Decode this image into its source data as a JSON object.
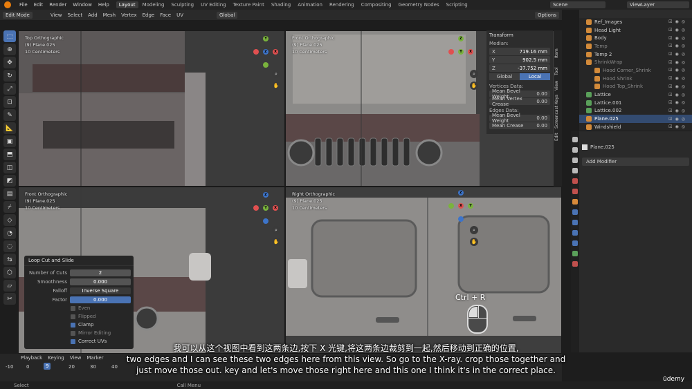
{
  "app": {
    "menus": [
      "File",
      "Edit",
      "Render",
      "Window",
      "Help"
    ],
    "workspaces": [
      "Layout",
      "Modeling",
      "Sculpting",
      "UV Editing",
      "Texture Paint",
      "Shading",
      "Animation",
      "Rendering",
      "Compositing",
      "Geometry Nodes",
      "Scripting"
    ],
    "active_workspace": "Layout",
    "scene": "Scene",
    "view_layer": "ViewLayer"
  },
  "header": {
    "mode": "Edit Mode",
    "menus": [
      "View",
      "Select",
      "Add",
      "Mesh",
      "Vertex",
      "Edge",
      "Face",
      "UV"
    ],
    "orientation": "Global",
    "options": "Options"
  },
  "viewports": {
    "top": {
      "name": "Top Orthographic",
      "object": "(9) Plane.025",
      "scale": "10 Centimeters"
    },
    "front": {
      "name": "Front Orthographic",
      "object": "(9) Plane.025",
      "scale": "10 Centimeters"
    },
    "front2": {
      "name": "Front Orthographic",
      "object": "(9) Plane.025",
      "scale": "10 Centimeters"
    },
    "right": {
      "name": "Right Orthographic",
      "object": "(9) Plane.025",
      "scale": "10 Centimeters"
    }
  },
  "npanel": {
    "title": "Transform",
    "median": "Median:",
    "x_label": "X",
    "x": "719.16 mm",
    "y_label": "Y",
    "y": "902.5 mm",
    "z_label": "Z",
    "z": "-37.752 mm",
    "global": "Global",
    "local": "Local",
    "vertices_data": "Vertices Data:",
    "mean_bevel_weight_v": "Mean Bevel Weight",
    "mean_bevel_weight_v_val": "0.00",
    "mean_vertex_crease": "Mean Vertex Crease",
    "mean_vertex_crease_val": "0.00",
    "edges_data": "Edges Data:",
    "mean_bevel_weight_e": "Mean Bevel Weight",
    "mean_bevel_weight_e_val": "0.00",
    "mean_crease": "Mean Crease",
    "mean_crease_val": "0.00",
    "tabs": [
      "Item",
      "Tool",
      "View",
      "Screencast Keys",
      "Edit"
    ]
  },
  "outliner": {
    "items": [
      {
        "name": "Ref_Images",
        "selected": false
      },
      {
        "name": "Head Light",
        "selected": false
      },
      {
        "name": "Body",
        "selected": false
      },
      {
        "name": "Temp",
        "selected": false
      },
      {
        "name": "Temp 2",
        "selected": false
      },
      {
        "name": "ShrinkWrap",
        "selected": false
      },
      {
        "name": "Hood Corner_Shrink",
        "selected": false
      },
      {
        "name": "Hood Shrink",
        "selected": false
      },
      {
        "name": "Hood Top_Shrink",
        "selected": false
      },
      {
        "name": "Lattice",
        "selected": false
      },
      {
        "name": "Lattice.001",
        "selected": false
      },
      {
        "name": "Lattice.002",
        "selected": false
      },
      {
        "name": "Plane.025",
        "selected": true
      },
      {
        "name": "Windshield",
        "selected": false
      }
    ]
  },
  "properties": {
    "object": "Plane.025",
    "add_modifier": "Add Modifier"
  },
  "loopcut": {
    "title": "Loop Cut and Slide",
    "number_of_cuts_label": "Number of Cuts",
    "number_of_cuts": "2",
    "smoothness_label": "Smoothness",
    "smoothness": "0.000",
    "falloff_label": "Falloff",
    "falloff": "Inverse Square",
    "factor_label": "Factor",
    "factor": "0.000",
    "even": "Even",
    "flipped": "Flipped",
    "clamp": "Clamp",
    "mirror_editing": "Mirror Editing",
    "correct_uvs": "Correct UVs"
  },
  "timeline": {
    "menus": [
      "Playback",
      "Keying",
      "View",
      "Marker"
    ],
    "frames": [
      "-10",
      "0",
      "9",
      "20",
      "30",
      "40"
    ],
    "current_frame": "9"
  },
  "status": {
    "select": "Select",
    "call_menu": "Call Menu"
  },
  "overlay": {
    "shortcut": "Ctrl + R",
    "watermark": "ūdemy"
  },
  "subtitles": {
    "zh": "我可以从这个视图中看到这两条边,按下 X 光键,将这两条边裁剪到一起,然后移动到正确的位置,",
    "en1": "two edges and I can see these two edges here from this view. So go to the X-ray. crop those together and",
    "en2": "just move those out. key and let's move those right here and this one I think it's in the correct place."
  }
}
